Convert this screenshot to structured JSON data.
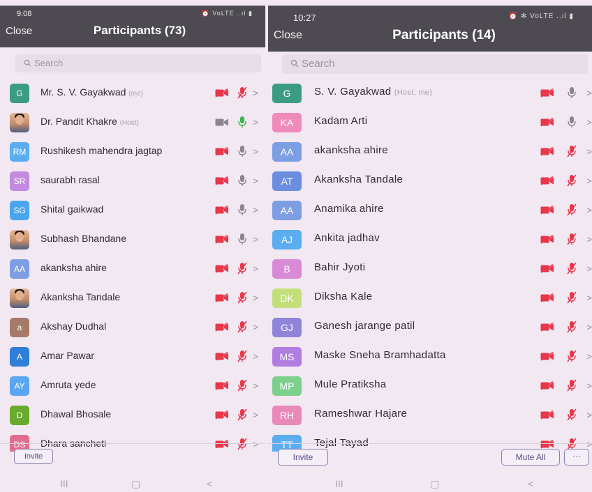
{
  "colors": {
    "topbar": "#4e4a52",
    "muted_red": "#e8364a",
    "video_gray": "#8a8590",
    "mic_green": "#39b54a"
  },
  "left": {
    "status": {
      "time": "9:08",
      "icons": "⏰ VoLTE ..ıl ▮"
    },
    "close": "Close",
    "title": "Participants (73)",
    "search_placeholder": "Search",
    "participants": [
      {
        "initials": "G",
        "color": "#3b9c82",
        "name": "Mr. S. V. Gayakwad",
        "tag": "(me)",
        "video": "off",
        "mic": "muted"
      },
      {
        "initials": "",
        "photo": true,
        "color": "#d8a78a",
        "name": "Dr. Pandit Khakre",
        "tag": "(Host)",
        "video": "on",
        "mic": "active"
      },
      {
        "initials": "RM",
        "color": "#5aaef0",
        "name": "Rushikesh mahendra jagtap",
        "tag": "",
        "video": "off",
        "mic": "idle"
      },
      {
        "initials": "SR",
        "color": "#c38be0",
        "name": "saurabh rasal",
        "tag": "",
        "video": "off",
        "mic": "idle"
      },
      {
        "initials": "SG",
        "color": "#4aa6ec",
        "name": "Shital gaikwad",
        "tag": "",
        "video": "off",
        "mic": "idle"
      },
      {
        "initials": "",
        "photo": true,
        "color": "#c49478",
        "name": "Subhash Bhandane",
        "tag": "",
        "video": "off",
        "mic": "idle"
      },
      {
        "initials": "AA",
        "color": "#7e9ee4",
        "name": "akanksha ahire",
        "tag": "",
        "video": "off",
        "mic": "muted"
      },
      {
        "initials": "",
        "photo": true,
        "color": "#c9a48e",
        "name": "Akanksha Tandale",
        "tag": "",
        "video": "off",
        "mic": "muted"
      },
      {
        "initials": "a",
        "color": "#a67a6a",
        "name": "Akshay Dudhal",
        "tag": "",
        "video": "off",
        "mic": "muted"
      },
      {
        "initials": "A",
        "color": "#2f7ed8",
        "name": "Amar Pawar",
        "tag": "",
        "video": "off",
        "mic": "muted"
      },
      {
        "initials": "AY",
        "color": "#5aa6f2",
        "name": "Amruta yede",
        "tag": "",
        "video": "off",
        "mic": "muted"
      },
      {
        "initials": "D",
        "color": "#6aab2e",
        "name": "Dhawal Bhosale",
        "tag": "",
        "video": "off",
        "mic": "muted"
      },
      {
        "initials": "DS",
        "color": "#e26c8e",
        "name": "Dhara sancheti",
        "tag": "",
        "video": "off",
        "mic": "muted"
      }
    ],
    "invite": "Invite",
    "nav": {
      "recent": "III",
      "home": "▢",
      "back": "<"
    }
  },
  "right": {
    "status": {
      "time": "10:27",
      "icons": "⏰ ✻ VoLTE ..ıl ▮"
    },
    "close": "Close",
    "title": "Participants (14)",
    "search_placeholder": "Search",
    "participants": [
      {
        "initials": "G",
        "color": "#3b9c82",
        "name": "S. V. Gayakwad",
        "tag": "(Host, me)",
        "video": "off",
        "mic": "idle"
      },
      {
        "initials": "KA",
        "color": "#f08aba",
        "name": "Kadam Arti",
        "tag": "",
        "video": "off",
        "mic": "idle"
      },
      {
        "initials": "AA",
        "color": "#7e9ee4",
        "name": "akanksha ahire",
        "tag": "",
        "video": "off",
        "mic": "muted"
      },
      {
        "initials": "AT",
        "color": "#6b8ee0",
        "name": "Akanksha Tandale",
        "tag": "",
        "video": "off",
        "mic": "muted"
      },
      {
        "initials": "AA",
        "color": "#7e9ee4",
        "name": "Anamika ahire",
        "tag": "",
        "video": "off",
        "mic": "muted"
      },
      {
        "initials": "AJ",
        "color": "#5aaef0",
        "name": "Ankita jadhav",
        "tag": "",
        "video": "off",
        "mic": "muted"
      },
      {
        "initials": "B",
        "color": "#d98ad6",
        "name": "Bahir Jyoti",
        "tag": "",
        "video": "off",
        "mic": "muted"
      },
      {
        "initials": "DK",
        "color": "#c2e07a",
        "name": "Diksha Kale",
        "tag": "",
        "video": "off",
        "mic": "muted"
      },
      {
        "initials": "GJ",
        "color": "#8f84d8",
        "name": "Ganesh jarange patil",
        "tag": "",
        "video": "off",
        "mic": "muted"
      },
      {
        "initials": "MS",
        "color": "#b07ee0",
        "name": "Maske Sneha Bramhadatta",
        "tag": "",
        "video": "off",
        "mic": "muted"
      },
      {
        "initials": "MP",
        "color": "#7cd08c",
        "name": "Mule Pratiksha",
        "tag": "",
        "video": "off",
        "mic": "muted"
      },
      {
        "initials": "RH",
        "color": "#e889b8",
        "name": "Rameshwar Hajare",
        "tag": "",
        "video": "off",
        "mic": "muted"
      },
      {
        "initials": "TT",
        "color": "#5aaef0",
        "name": "Tejal Tayad",
        "tag": "",
        "video": "off",
        "mic": "muted"
      }
    ],
    "invite": "Invite",
    "mute_all": "Mute All",
    "more": "···",
    "nav": {
      "recent": "III",
      "home": "▢",
      "back": "<"
    }
  }
}
